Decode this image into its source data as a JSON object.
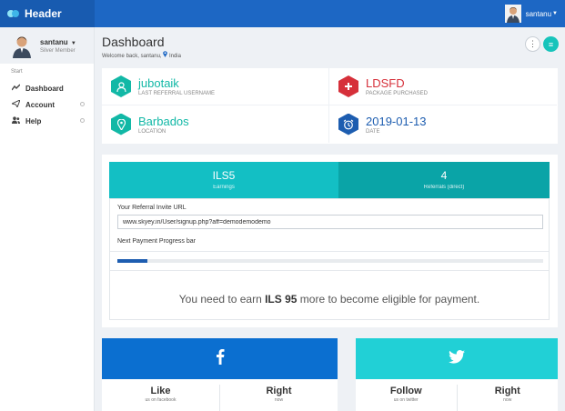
{
  "header": {
    "title": "Header",
    "username": "santanu"
  },
  "sidebar": {
    "profile": {
      "name": "santanu",
      "role": "Silver Member"
    },
    "section_label": "Start",
    "items": [
      {
        "label": "Dashboard",
        "icon": "chart-line-icon"
      },
      {
        "label": "Account",
        "icon": "send-icon"
      },
      {
        "label": "Help",
        "icon": "users-icon"
      }
    ]
  },
  "page": {
    "title": "Dashboard",
    "subtitle_prefix": "Welcome back, santanu,",
    "location": "India"
  },
  "stats": [
    {
      "value": "jubotaik",
      "label": "LAST REFERRAL USERNAME",
      "color": "#12b8a6",
      "icon": "user-icon"
    },
    {
      "value": "LDSFD",
      "label": "PACKAGE PURCHASED",
      "color": "#d6303a",
      "icon": "plus-icon"
    },
    {
      "value": "Barbados",
      "label": "LOCATION",
      "color": "#12b8a6",
      "icon": "map-pin-icon"
    },
    {
      "value": "2019-01-13",
      "label": "DATE",
      "color": "#1d5db0",
      "icon": "alarm-clock-icon"
    }
  ],
  "referral": {
    "earnings_value": "ILS5",
    "earnings_label": "Earnings",
    "referrals_value": "4",
    "referrals_label": "Referrals (direct)",
    "invite_label": "Your Referral Invite URL",
    "invite_url": "www.skyey.in/User/signup.php?aff=demodemodemo",
    "progress_label": "Next Payment Progress bar",
    "progress_fraction": 0.07,
    "msg_before": "You need to earn",
    "msg_amount": "ILS 95",
    "msg_after": "more to become eligible for payment."
  },
  "social": {
    "facebook": {
      "left_value": "Like",
      "left_label": "us on facebook",
      "right_value": "Right",
      "right_label": "now",
      "color": "#0b6fd0"
    },
    "twitter": {
      "left_value": "Follow",
      "left_label": "us on twitter",
      "right_value": "Right",
      "right_label": "now",
      "color": "#21d0d6"
    }
  }
}
